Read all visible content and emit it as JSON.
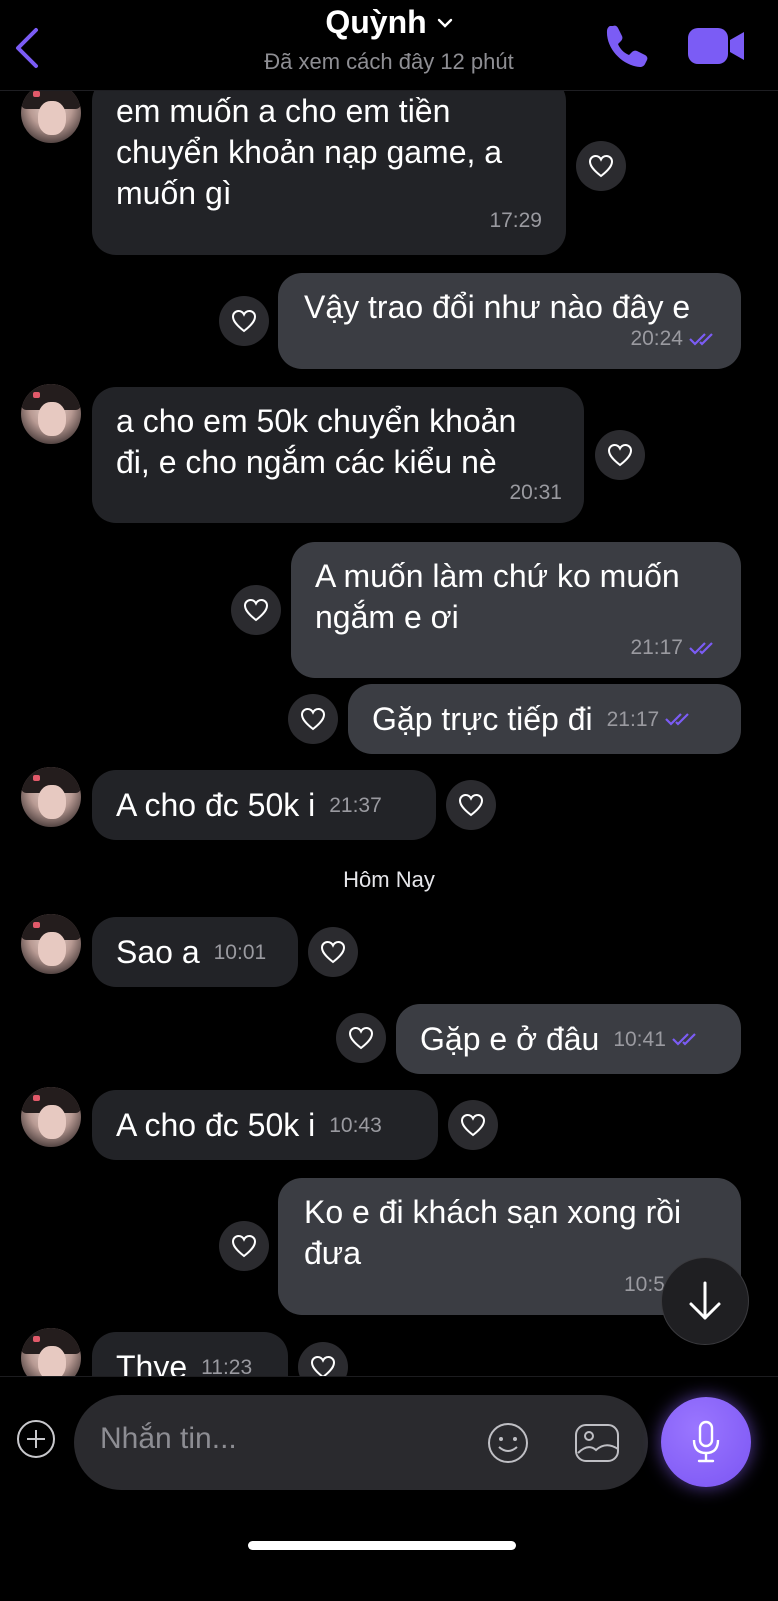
{
  "header": {
    "contact_name": "Quỳnh",
    "last_seen": "Đã xem cách đây 12 phút",
    "icons": [
      "back-chevron-icon",
      "chevron-down-icon",
      "phone-icon",
      "video-camera-icon"
    ],
    "accent_color": "#7b5cf5"
  },
  "messages": [
    {
      "dir": "in",
      "text_lines": [
        "em muốn a cho em tiền",
        "chuyển khoản nạp game, a",
        "muốn gì"
      ],
      "time": "17:29"
    },
    {
      "dir": "out",
      "text_lines": [
        "Vậy trao đổi như nào đây e"
      ],
      "time": "20:24",
      "status": "seen"
    },
    {
      "dir": "in",
      "text_lines": [
        "a cho em 50k chuyển khoản",
        "đi, e cho ngắm các kiểu nè"
      ],
      "time": "20:31"
    },
    {
      "dir": "out",
      "text_lines": [
        "A muốn làm chứ ko muốn",
        "ngắm e ơi"
      ],
      "time": "21:17",
      "status": "seen"
    },
    {
      "dir": "out",
      "text_lines": [
        "Gặp trực tiếp đi"
      ],
      "time": "21:17",
      "status": "seen"
    },
    {
      "dir": "in",
      "text_lines": [
        "A cho đc 50k i"
      ],
      "time": "21:37"
    },
    {
      "dir": "in",
      "text_lines": [
        "Sao a"
      ],
      "time": "10:01"
    },
    {
      "dir": "out",
      "text_lines": [
        "Gặp e ở đâu"
      ],
      "time": "10:41",
      "status": "seen"
    },
    {
      "dir": "in",
      "text_lines": [
        "A cho đc 50k i"
      ],
      "time": "10:43"
    },
    {
      "dir": "out",
      "text_lines": [
        "Ko e đi khách sạn xong rồi",
        "đưa"
      ],
      "time": "10:5",
      "status": "seen"
    },
    {
      "dir": "in",
      "text_lines": [
        "Thye"
      ],
      "time": "11:23"
    }
  ],
  "date_separator": "Hôm Nay",
  "composer": {
    "placeholder": "Nhắn tin...",
    "icons": [
      "plus-circle-icon",
      "emoji-icon",
      "gallery-icon",
      "microphone-icon"
    ]
  },
  "colors": {
    "incoming_bubble": "#222327",
    "outgoing_bubble": "#3b3d43",
    "read_tick": "#7b5cf5"
  }
}
